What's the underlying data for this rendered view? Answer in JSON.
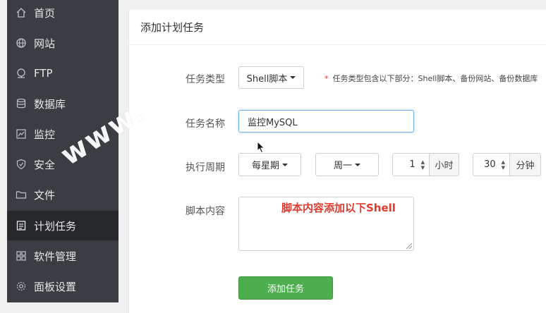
{
  "sidebar": {
    "items": [
      {
        "label": "首页",
        "icon": "home-icon"
      },
      {
        "label": "网站",
        "icon": "globe-icon"
      },
      {
        "label": "FTP",
        "icon": "ftp-icon"
      },
      {
        "label": "数据库",
        "icon": "database-icon"
      },
      {
        "label": "监控",
        "icon": "monitor-icon"
      },
      {
        "label": "安全",
        "icon": "shield-icon"
      },
      {
        "label": "文件",
        "icon": "folder-icon"
      },
      {
        "label": "计划任务",
        "icon": "calendar-icon",
        "active": true
      },
      {
        "label": "软件管理",
        "icon": "grid-icon"
      },
      {
        "label": "面板设置",
        "icon": "gear-icon"
      }
    ]
  },
  "panel": {
    "title": "添加计划任务",
    "task_type": {
      "label": "任务类型",
      "value": "Shell脚本"
    },
    "hint": "任务类型包含以下部分：Shell脚本、备份网站、备份数据库",
    "task_name": {
      "label": "任务名称",
      "value": "监控MySQL"
    },
    "cycle": {
      "label": "执行周期",
      "period": "每星期",
      "weekday": "周一",
      "hour_value": "1",
      "hour_unit": "小时",
      "minute_value": "30",
      "minute_unit": "分钟"
    },
    "script": {
      "label": "脚本内容",
      "annotation": "脚本内容添加以下Shell"
    },
    "submit_label": "添加任务"
  },
  "watermark": "www.",
  "colors": {
    "sidebar_bg": "#3a3d42",
    "sidebar_active": "#26282b",
    "submit_green": "#4cae4c",
    "annotation_red": "#e23a2f",
    "focus_blue": "#6fb1e8"
  }
}
